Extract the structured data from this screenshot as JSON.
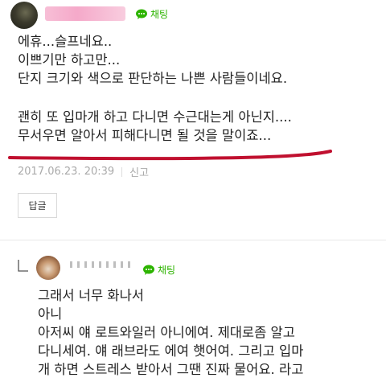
{
  "comment": {
    "chat_label": "채팅",
    "lines": [
      "에휴...슬프네요..",
      "이쁘기만 하고만...",
      "단지 크기와 색으로 판단하는 나쁜 사람들이네요.",
      "괜히 또 입마개 하고 다니면 수근대는게 아닌지....",
      "무서우면 알아서 피해다니면 될 것을 말이죠..."
    ],
    "timestamp": "2017.06.23. 20:39",
    "report_label": "신고",
    "reply_button_label": "답글",
    "underline_color": "#c0102f"
  },
  "reply": {
    "chat_label": "채팅",
    "lines": [
      "그래서 너무 화나서",
      "아니",
      "아저씨 얘 로트와일러 아니에여. 제대로좀 알고",
      "다니세여. 얘 래브라도 에여 햇어여. 그리고 입마",
      "개 하면 스트레스 받아서 그땐 진짜 물어요. 라고"
    ]
  },
  "colors": {
    "chat_green": "#2db400",
    "meta_gray": "#aaaaaa"
  }
}
